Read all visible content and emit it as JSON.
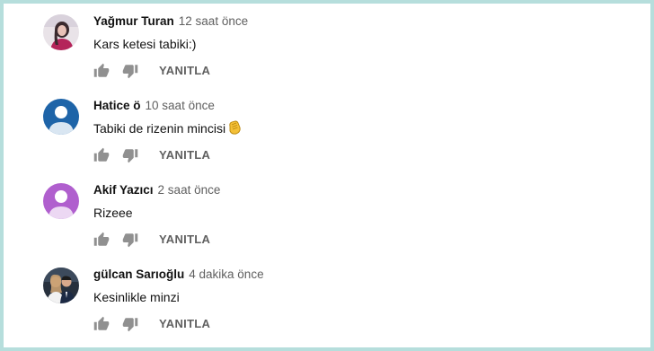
{
  "comments": [
    {
      "author": "Yağmur Turan",
      "time": "12 saat önce",
      "text": "Kars ketesi tabiki:)",
      "avatar": "photo-girl",
      "reply_label": "YANITLA"
    },
    {
      "author": "Hatice ö",
      "time": "10 saat önce",
      "text": "Tabiki de rizenin mincisi",
      "text_emoji": "clapping-hands-icon",
      "avatar": "default-person-blue",
      "reply_label": "YANITLA"
    },
    {
      "author": "Akif Yazıcı",
      "time": "2 saat önce",
      "text": "Rizeee",
      "avatar": "default-person-purple",
      "reply_label": "YANITLA"
    },
    {
      "author": "gülcan Sarıoğlu",
      "time": "4 dakika önce",
      "text": "Kesinlikle minzi",
      "avatar": "photo-couple",
      "reply_label": "YANITLA"
    }
  ],
  "colors": {
    "background_border": "#b6dedc",
    "author_text": "#111111",
    "meta_text": "#606060",
    "avatar_blue": "#1e64a8",
    "avatar_purple": "#b05fce",
    "icon_gray": "#909090"
  },
  "icons": {
    "like": "thumb-up-icon",
    "dislike": "thumb-down-icon"
  }
}
